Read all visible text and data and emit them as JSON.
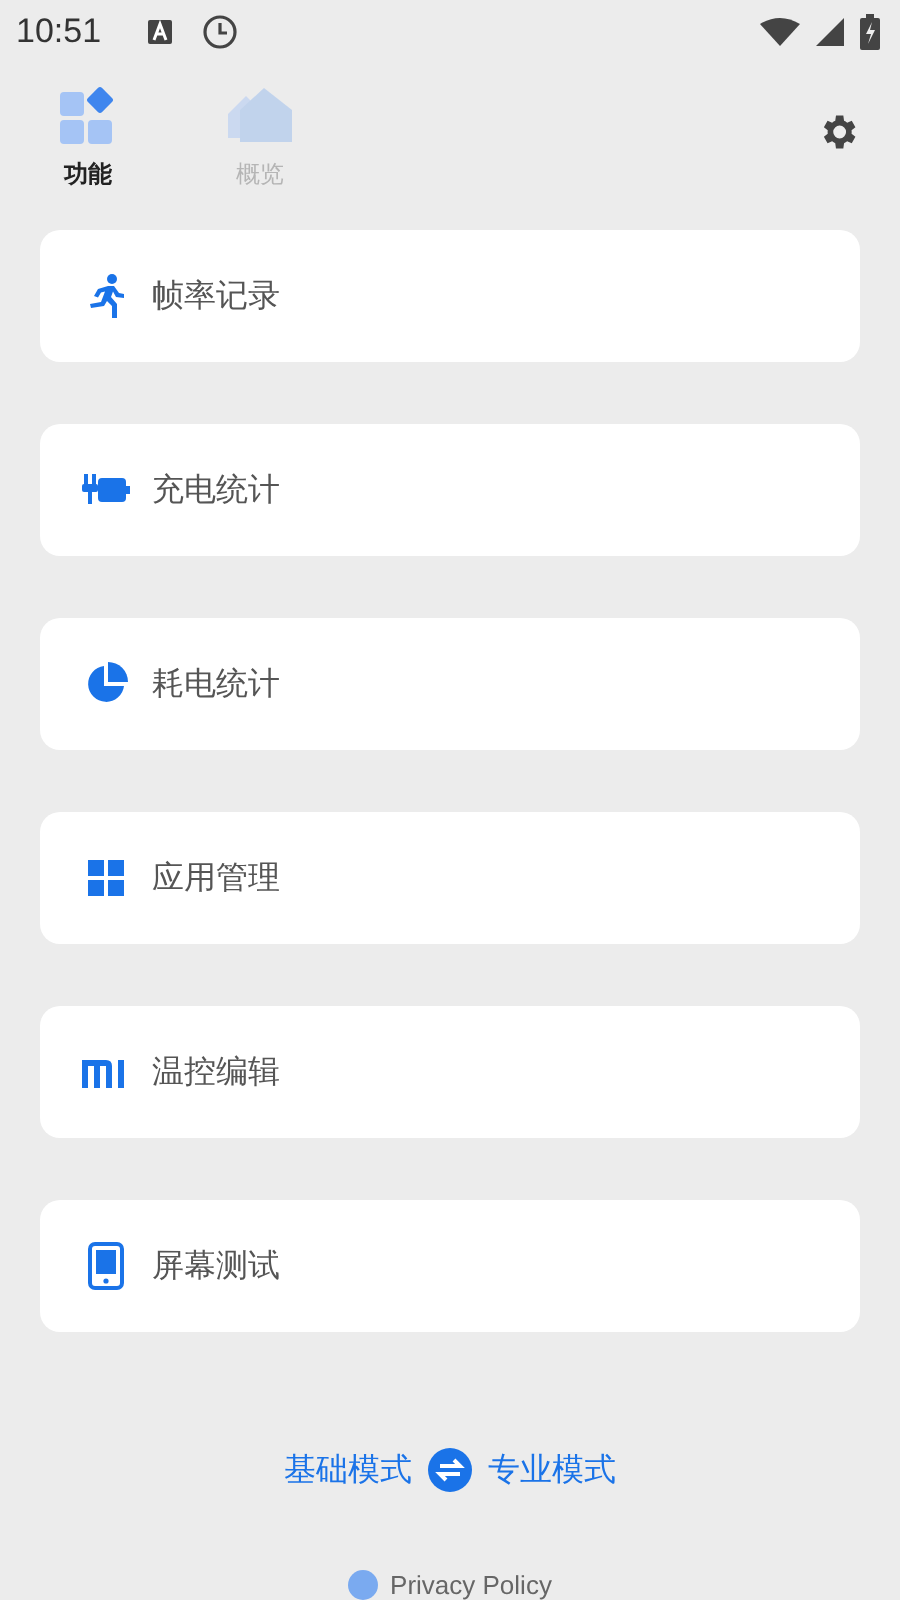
{
  "status_bar": {
    "time": "10:51"
  },
  "tabs": [
    {
      "label": "功能",
      "selected": true,
      "kind": "grid"
    },
    {
      "label": "概览",
      "selected": false,
      "kind": "house"
    }
  ],
  "menu": [
    {
      "label": "帧率记录",
      "kind": "run"
    },
    {
      "label": "充电统计",
      "kind": "charge"
    },
    {
      "label": "耗电统计",
      "kind": "pie"
    },
    {
      "label": "应用管理",
      "kind": "apps"
    },
    {
      "label": "温控编辑",
      "kind": "bars"
    },
    {
      "label": "屏幕测试",
      "kind": "phone"
    }
  ],
  "mode_switch": {
    "left": "基础模式",
    "right": "专业模式"
  },
  "footer": {
    "link": "Privacy Policy"
  }
}
